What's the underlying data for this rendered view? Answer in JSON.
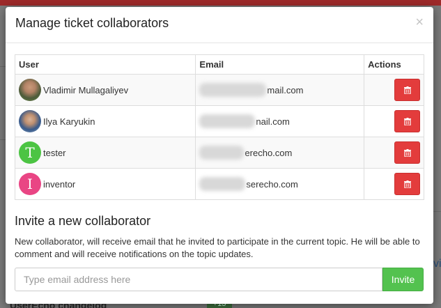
{
  "background": {
    "bottom_text": "UserEcho changelog",
    "badge": "+13",
    "edge_char": "vi"
  },
  "modal": {
    "title": "Manage ticket collaborators",
    "close_glyph": "×"
  },
  "table": {
    "headers": {
      "user": "User",
      "email": "Email",
      "actions": "Actions"
    },
    "rows": [
      {
        "name": "Vladimir Mullagaliyev",
        "avatar": "photo",
        "email_suffix": "mail.com"
      },
      {
        "name": "Ilya Karyukin",
        "avatar": "photo",
        "email_suffix": "nail.com"
      },
      {
        "name": "tester",
        "avatar": "T",
        "email_suffix": "erecho.com"
      },
      {
        "name": "inventor",
        "avatar": "I",
        "email_suffix": "serecho.com"
      }
    ]
  },
  "invite": {
    "title": "Invite a new collaborator",
    "description": "New collaborator, will receive email that he invited to participate in the current topic. He will be able to comment and will receive notifications on the topic updates.",
    "placeholder": "Type email address here",
    "button_label": "Invite"
  },
  "colors": {
    "delete_button": "#e33c3c",
    "invite_button": "#53c24f",
    "avatar_t": "#4cc443",
    "avatar_i": "#e94584"
  },
  "icons": {
    "delete": "trash-icon",
    "close": "close-icon"
  }
}
